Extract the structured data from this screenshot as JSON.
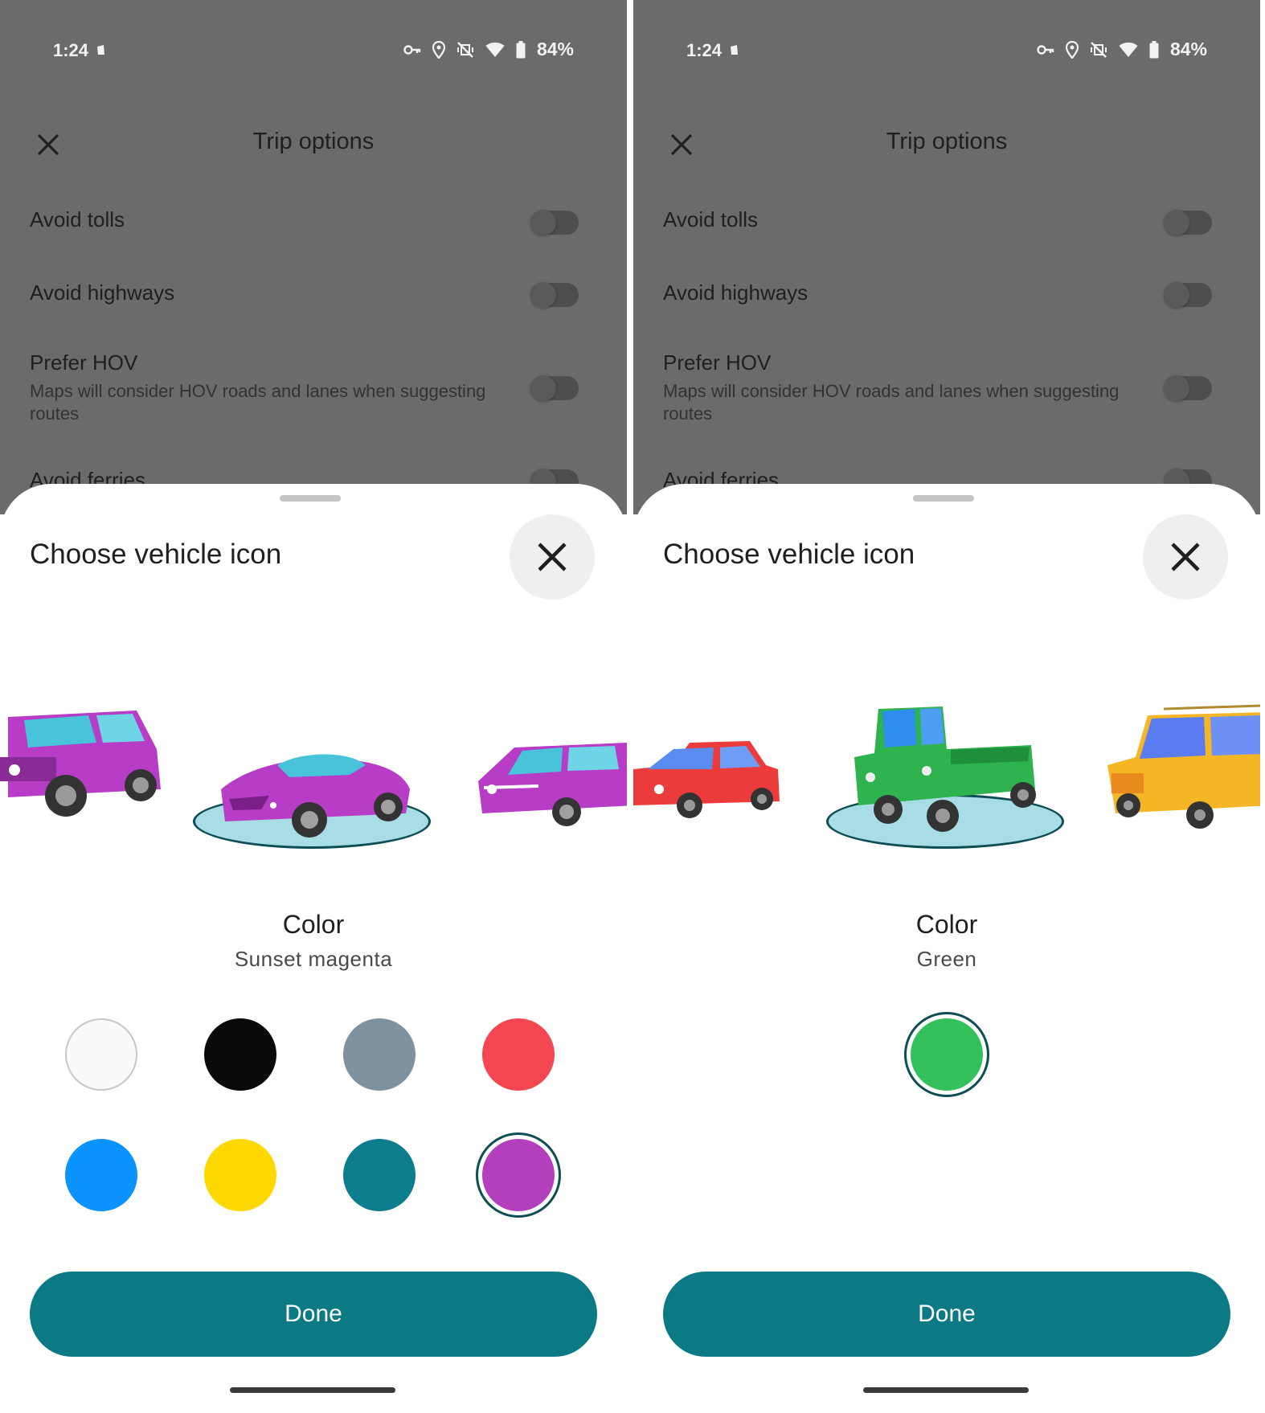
{
  "screens": [
    {
      "status": {
        "time": "1:24",
        "battery": "84%"
      },
      "topbar": {
        "title": "Trip options"
      },
      "options": [
        {
          "label": "Avoid tolls",
          "sub": ""
        },
        {
          "label": "Avoid highways",
          "sub": ""
        },
        {
          "label": "Prefer HOV",
          "sub": "Maps will consider HOV roads and lanes when suggesting routes"
        },
        {
          "label": "Avoid ferries",
          "sub": ""
        }
      ],
      "sheet": {
        "title": "Choose vehicle icon",
        "color_label": "Color",
        "color_name": "Sunset magenta",
        "done_label": "Done"
      },
      "swatches": [
        {
          "name": "white",
          "hex": "#f8fafc",
          "selected": false
        },
        {
          "name": "black",
          "hex": "#0a0a0a",
          "selected": false
        },
        {
          "name": "gray",
          "hex": "#7e919e",
          "selected": false
        },
        {
          "name": "red",
          "hex": "#f24651",
          "selected": false
        },
        {
          "name": "blue",
          "hex": "#0a92ff",
          "selected": false
        },
        {
          "name": "yellow",
          "hex": "#ffd800",
          "selected": false
        },
        {
          "name": "teal",
          "hex": "#0b7d8c",
          "selected": false
        },
        {
          "name": "magenta",
          "hex": "#b43fbd",
          "selected": true
        }
      ],
      "vehicle_color": "#b73cc6"
    },
    {
      "status": {
        "time": "1:24",
        "battery": "84%"
      },
      "topbar": {
        "title": "Trip options"
      },
      "options": [
        {
          "label": "Avoid tolls",
          "sub": ""
        },
        {
          "label": "Avoid highways",
          "sub": ""
        },
        {
          "label": "Prefer HOV",
          "sub": "Maps will consider HOV roads and lanes when suggesting routes"
        },
        {
          "label": "Avoid ferries",
          "sub": ""
        }
      ],
      "sheet": {
        "title": "Choose vehicle icon",
        "color_label": "Color",
        "color_name": "Green",
        "done_label": "Done"
      },
      "swatches": [
        {
          "name": "green",
          "hex": "#34c05a",
          "selected": true
        }
      ],
      "vehicle_color": "#2fb34f"
    }
  ]
}
